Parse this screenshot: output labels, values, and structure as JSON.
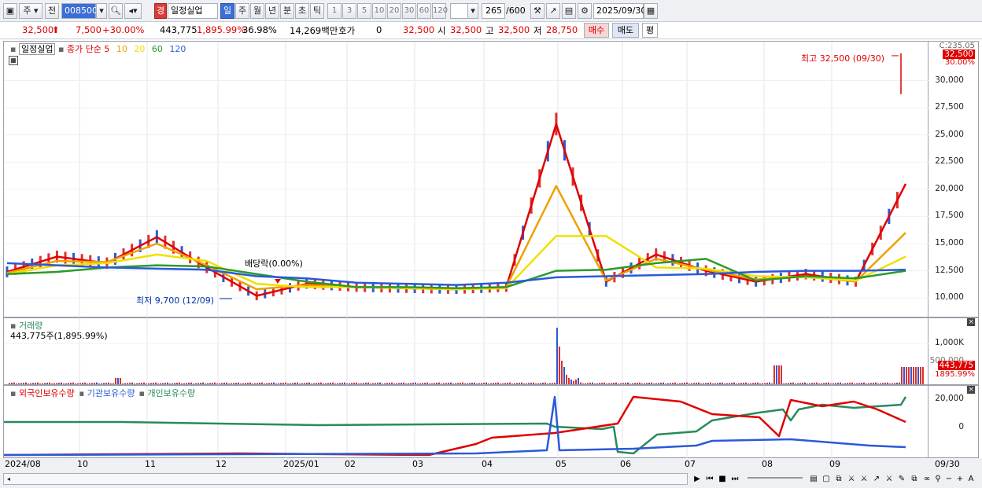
{
  "toolbar": {
    "mode": "주",
    "prev": "전",
    "code": "008500",
    "alert_badge": "경",
    "name": "일정실업",
    "periods": [
      "일",
      "주",
      "월",
      "년",
      "분",
      "초",
      "틱"
    ],
    "intervals": [
      "1",
      "3",
      "5",
      "10",
      "20",
      "30",
      "60",
      "120"
    ],
    "count": "265",
    "count_total": "/600",
    "date": "2025/09/30"
  },
  "quote": {
    "price": "32,500",
    "change": "7,500",
    "change_pct": "+30.00%",
    "volume": "443,775",
    "volume_pct": "1,895.99%",
    "turnover_pct": "36.98%",
    "amount": "14,269백만",
    "hoga_label": "호가",
    "hoga_value": "0",
    "close_val": "32,500",
    "open_label": "시",
    "open_val": "32,500",
    "high_label": "고",
    "high_val": "32,500",
    "low_label": "저",
    "low_val": "28,750",
    "buy_label": "매수",
    "sell_label": "매도",
    "avg_label": "평"
  },
  "price_panel": {
    "name": "일정실업",
    "ma_label": "종가 단순",
    "ma_periods": [
      "5",
      "10",
      "20",
      "60",
      "120"
    ],
    "ma_colors": [
      "#e00000",
      "#f0a000",
      "#f0e000",
      "#2a9a2a",
      "#2a5ad8"
    ],
    "yticks": [
      "30,000",
      "27,500",
      "25,000",
      "22,500",
      "20,000",
      "17,500",
      "15,000",
      "12,500",
      "10,000"
    ],
    "top_label": "C:235.05",
    "current_price": "32,500",
    "current_pct": "30.00%",
    "high_annot": "최고 32,500 (09/30)",
    "low_annot": "최저 9,700 (12/09)",
    "dividend_annot": "배당락(0.00%)"
  },
  "volume_panel": {
    "title": "거래량",
    "sub": "443,775주(1,895.99%)",
    "ytick": "1,000K",
    "ytick_partial": "500,000",
    "current": "443,775",
    "current_pct": "1895.99%"
  },
  "holding_panel": {
    "series": [
      "외국인보유수량",
      "기관보유수량",
      "개인보유수량"
    ],
    "series_colors": [
      "#e00000",
      "#2a5ad8",
      "#2a8a5a"
    ],
    "yticks": [
      "20,000",
      "0"
    ]
  },
  "xaxis": {
    "labels": [
      "2024/08",
      "10",
      "11",
      "12",
      "2025/01",
      "02",
      "03",
      "04",
      "05",
      "06",
      "07",
      "08",
      "09"
    ],
    "last": "09/30"
  },
  "chart_data": {
    "type": "line",
    "xlabel": "",
    "ylabel": "",
    "ylim": [
      9000,
      33000
    ],
    "series": [
      {
        "name": "5",
        "values": [
          12400,
          13800,
          13200,
          15600,
          12800,
          10200,
          11300,
          11000,
          10900,
          10800,
          11000,
          26000,
          11500,
          14000,
          12500,
          11500,
          12200,
          11500,
          20500
        ]
      },
      {
        "name": "10",
        "values": [
          12300,
          13400,
          13300,
          15000,
          13000,
          10800,
          11200,
          11000,
          10900,
          10800,
          11000,
          20300,
          11600,
          13600,
          12600,
          11700,
          12000,
          11500,
          16000
        ]
      },
      {
        "name": "20",
        "values": [
          12200,
          13000,
          13200,
          14000,
          13400,
          11300,
          11000,
          11000,
          10900,
          10800,
          10900,
          15700,
          15700,
          12800,
          12700,
          12000,
          11900,
          11600,
          13800
        ]
      },
      {
        "name": "60",
        "values": [
          12200,
          12400,
          12800,
          13000,
          12900,
          12200,
          11500,
          11000,
          11000,
          10900,
          11000,
          12500,
          12600,
          13200,
          13600,
          11600,
          12000,
          11800,
          12500
        ]
      },
      {
        "name": "120",
        "values": [
          13200,
          13000,
          12800,
          12700,
          12600,
          12000,
          11800,
          11400,
          11300,
          11200,
          11400,
          11900,
          12000,
          12100,
          12200,
          12400,
          12500,
          12500,
          12600
        ]
      }
    ]
  }
}
